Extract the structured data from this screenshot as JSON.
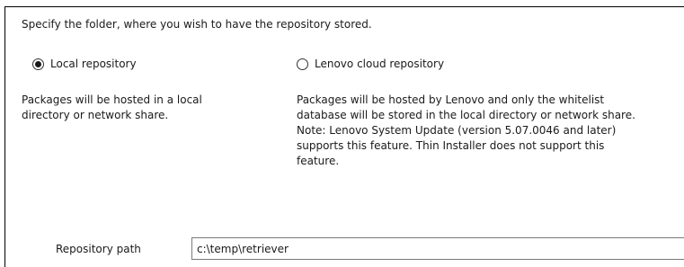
{
  "heading": "Specify the folder, where you wish to have the repository stored.",
  "options": {
    "local": {
      "label": "Local repository",
      "selected": true,
      "description": " Packages will be hosted in a local\ndirectory or network share."
    },
    "cloud": {
      "label": "Lenovo cloud repository",
      "selected": false,
      "description": " Packages will be hosted by Lenovo and only the whitelist\ndatabase will be stored in the local directory or network share.\n Note: Lenovo System Update (version 5.07.0046 and later)\nsupports this feature. Thin Installer does not support this\nfeature."
    }
  },
  "repository_path": {
    "label": "Repository path",
    "value": "c:\\temp\\retriever"
  }
}
